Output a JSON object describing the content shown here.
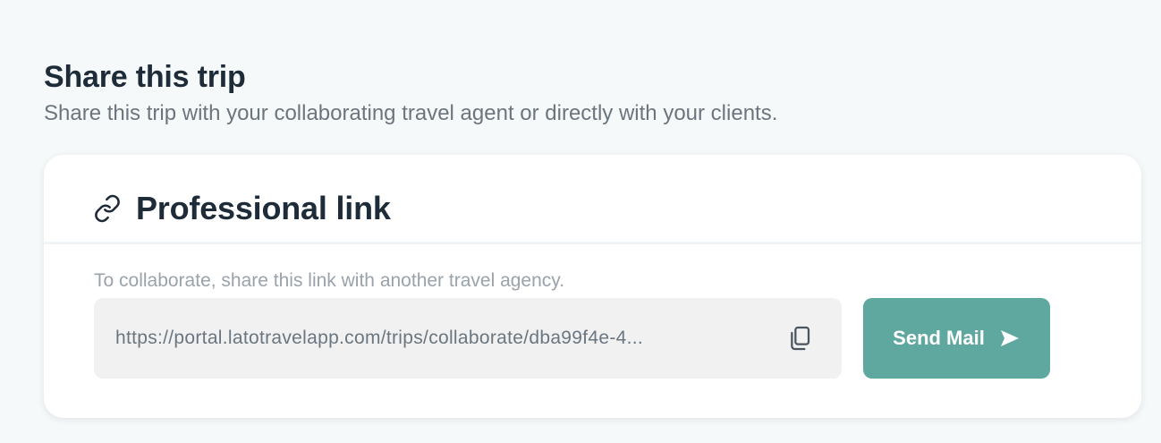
{
  "section": {
    "title": "Share this trip",
    "subtitle": "Share this trip with your collaborating travel agent or directly with your clients."
  },
  "card": {
    "title": "Professional link",
    "title_icon": "link-icon",
    "helper_text": "To collaborate, share this link with another travel agency.",
    "link_field": {
      "value": "https://portal.latotravelapp.com/trips/collaborate/dba99f4e-4...",
      "copy_icon": "copy-icon"
    },
    "send_button": {
      "label": "Send Mail",
      "icon": "send-icon"
    }
  },
  "colors": {
    "page_background": "#f6f9fa",
    "card_background": "#ffffff",
    "field_background": "#f1f1f1",
    "accent": "#5fa8a0",
    "heading": "#1e2b38",
    "muted_text": "#9aa2aa"
  }
}
